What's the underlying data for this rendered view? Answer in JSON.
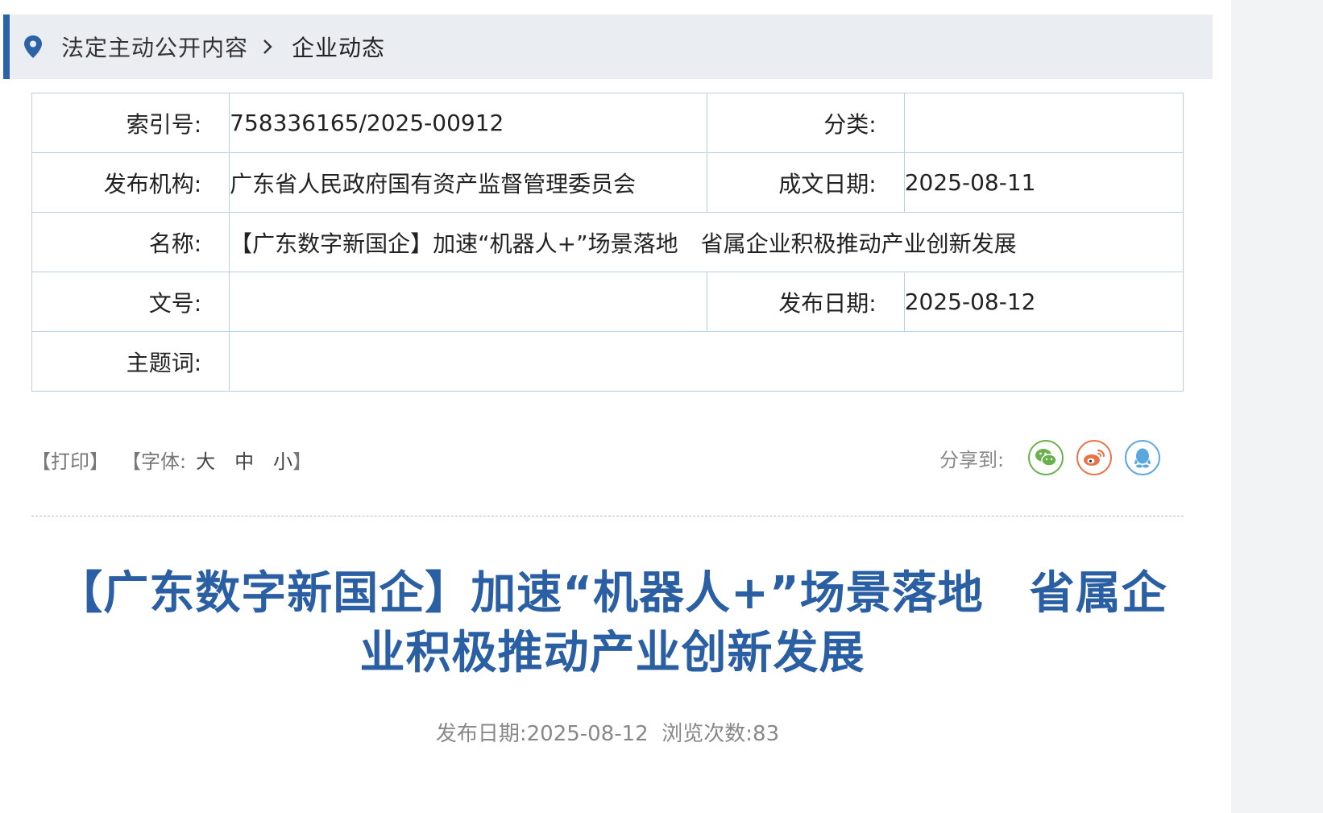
{
  "breadcrumb": {
    "section": "法定主动公开内容",
    "current": "企业动态"
  },
  "meta": {
    "index_label": "索引号:",
    "index_value": "758336165/2025-00912",
    "category_label": "分类:",
    "category_value": "",
    "publisher_label": "发布机构:",
    "publisher_value": "广东省人民政府国有资产监督管理委员会",
    "written_date_label": "成文日期:",
    "written_date_value": "2025-08-11",
    "name_label": "名称:",
    "name_value": "【广东数字新国企】加速“机器人+”场景落地　省属企业积极推动产业创新发展",
    "doc_no_label": "文号:",
    "doc_no_value": "",
    "publish_date_label": "发布日期:",
    "publish_date_value": "2025-08-12",
    "keywords_label": "主题词:",
    "keywords_value": ""
  },
  "tools": {
    "print": "【打印】",
    "font_prefix": "【字体:",
    "font_large": "大",
    "font_medium": "中",
    "font_small": "小",
    "font_suffix": "】"
  },
  "share": {
    "label": "分享到:",
    "icons": [
      "wechat-icon",
      "weibo-icon",
      "qq-icon"
    ],
    "colors": {
      "wechat": "#6ab04c",
      "weibo": "#e8724a",
      "qq": "#5aa7e0"
    }
  },
  "article": {
    "title": "【广东数字新国企】加速“机器人+”场景落地　省属企业积极推动产业创新发展",
    "publish_label": "发布日期:",
    "publish_date": "2025-08-12",
    "views_label": "浏览次数:",
    "views": "83"
  },
  "colors": {
    "accent": "#2b63a6",
    "title": "#2a5fa3",
    "table_border": "#b9cfe5",
    "breadcrumb_bg": "#eaeef2"
  }
}
